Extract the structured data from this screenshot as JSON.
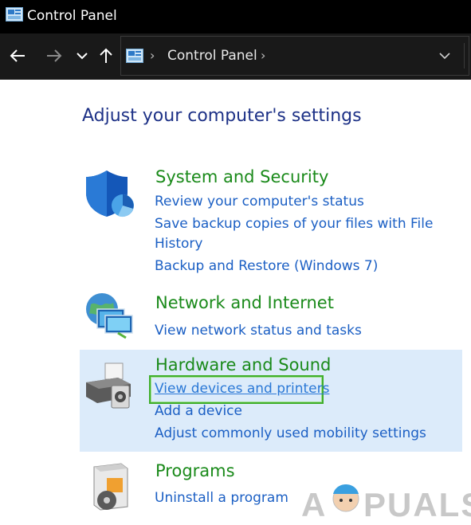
{
  "window": {
    "title": "Control Panel"
  },
  "nav": {
    "back_icon": "back-arrow-icon",
    "forward_icon": "forward-arrow-icon",
    "recent_icon": "chevron-down-icon",
    "up_icon": "up-arrow-icon"
  },
  "address": {
    "crumb": "Control Panel"
  },
  "main": {
    "heading": "Adjust your computer's settings",
    "categories": [
      {
        "title": "System and Security",
        "icon": "shield-icon",
        "links": [
          "Review your computer's status",
          "Save backup copies of your files with File",
          "History",
          "Backup and Restore (Windows 7)"
        ]
      },
      {
        "title": "Network and Internet",
        "icon": "network-globe-icon",
        "links": [
          "View network status and tasks"
        ]
      },
      {
        "title": "Hardware and Sound",
        "icon": "printer-icon",
        "links": [
          "View devices and printers",
          "Add a device",
          "Adjust commonly used mobility settings"
        ]
      },
      {
        "title": "Programs",
        "icon": "programs-box-icon",
        "links": [
          "Uninstall a program"
        ]
      }
    ]
  },
  "colors": {
    "title_bar": "#000000",
    "nav_bar": "#191919",
    "heading": "#1e3287",
    "category": "#1a8a1a",
    "link": "#1b5fc4",
    "highlight": "#dcebfa",
    "focus": "#3fae2a"
  },
  "watermark": {
    "text": "A PUALS"
  }
}
